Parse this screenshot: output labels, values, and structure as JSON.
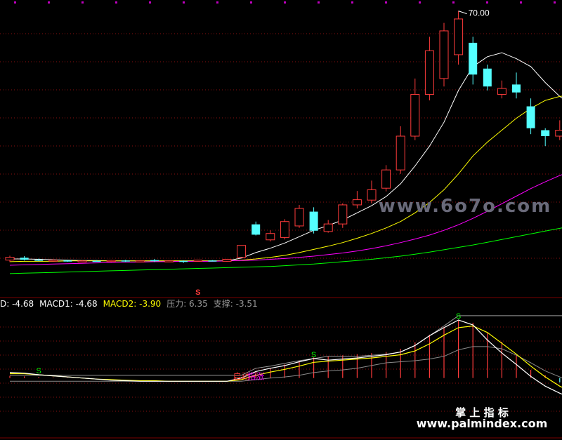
{
  "chart_data": [
    {
      "type": "candlestick",
      "pane": "price",
      "price_annotation": "70.00",
      "candles": [
        {
          "o": 7.3,
          "h": 8.4,
          "l": 6.8,
          "c": 8.0,
          "color": "up"
        },
        {
          "o": 7.9,
          "h": 8.3,
          "l": 7.2,
          "c": 7.4,
          "color": "down"
        },
        {
          "o": 7.4,
          "h": 7.7,
          "l": 7.0,
          "c": 7.2,
          "color": "down"
        },
        {
          "o": 7.2,
          "h": 7.5,
          "l": 6.9,
          "c": 7.3,
          "color": "up"
        },
        {
          "o": 7.2,
          "h": 7.4,
          "l": 6.9,
          "c": 7.1,
          "color": "down"
        },
        {
          "o": 7.0,
          "h": 7.3,
          "l": 6.8,
          "c": 7.1,
          "color": "up"
        },
        {
          "o": 7.1,
          "h": 7.3,
          "l": 6.9,
          "c": 7.0,
          "color": "down"
        },
        {
          "o": 7.0,
          "h": 7.3,
          "l": 6.8,
          "c": 7.2,
          "color": "up"
        },
        {
          "o": 7.2,
          "h": 7.4,
          "l": 6.8,
          "c": 7.0,
          "color": "down"
        },
        {
          "o": 7.0,
          "h": 7.3,
          "l": 6.8,
          "c": 7.1,
          "color": "up"
        },
        {
          "o": 7.1,
          "h": 7.6,
          "l": 6.8,
          "c": 7.3,
          "color": "down"
        },
        {
          "o": 7.1,
          "h": 7.3,
          "l": 6.9,
          "c": 7.0,
          "color": "up"
        },
        {
          "o": 7.0,
          "h": 7.2,
          "l": 6.6,
          "c": 7.1,
          "color": "down"
        },
        {
          "o": 7.0,
          "h": 7.4,
          "l": 6.9,
          "c": 7.3,
          "color": "up"
        },
        {
          "o": 7.2,
          "h": 7.3,
          "l": 7.0,
          "c": 7.1,
          "color": "down"
        },
        {
          "o": 7.0,
          "h": 7.6,
          "l": 6.9,
          "c": 7.5,
          "color": "up"
        },
        {
          "o": 8.0,
          "h": 11.0,
          "l": 7.9,
          "c": 11.0,
          "color": "up"
        },
        {
          "o": 16.3,
          "h": 17.0,
          "l": 13.5,
          "c": 13.7,
          "color": "down"
        },
        {
          "o": 12.4,
          "h": 14.8,
          "l": 12.0,
          "c": 14.0,
          "color": "up"
        },
        {
          "o": 13.0,
          "h": 17.6,
          "l": 12.5,
          "c": 17.0,
          "color": "up"
        },
        {
          "o": 15.9,
          "h": 21.2,
          "l": 15.4,
          "c": 20.3,
          "color": "up"
        },
        {
          "o": 19.5,
          "h": 20.6,
          "l": 14.0,
          "c": 14.7,
          "color": "down"
        },
        {
          "o": 14.5,
          "h": 17.4,
          "l": 14.2,
          "c": 16.4,
          "color": "up"
        },
        {
          "o": 16.4,
          "h": 21.6,
          "l": 15.4,
          "c": 21.2,
          "color": "up"
        },
        {
          "o": 21.2,
          "h": 24.7,
          "l": 20.3,
          "c": 22.5,
          "color": "up"
        },
        {
          "o": 22.4,
          "h": 27.3,
          "l": 21.6,
          "c": 25.0,
          "color": "up"
        },
        {
          "o": 25.4,
          "h": 31.2,
          "l": 24.6,
          "c": 30.0,
          "color": "up"
        },
        {
          "o": 30.0,
          "h": 41.0,
          "l": 29.0,
          "c": 38.5,
          "color": "up"
        },
        {
          "o": 38.5,
          "h": 53.0,
          "l": 37.5,
          "c": 49.0,
          "color": "up"
        },
        {
          "o": 49.0,
          "h": 63.5,
          "l": 47.5,
          "c": 60.0,
          "color": "up"
        },
        {
          "o": 53.0,
          "h": 67.0,
          "l": 51.0,
          "c": 65.0,
          "color": "up"
        },
        {
          "o": 59.0,
          "h": 70.0,
          "l": 56.5,
          "c": 68.0,
          "color": "up"
        },
        {
          "o": 62.0,
          "h": 63.5,
          "l": 51.5,
          "c": 54.0,
          "color": "down"
        },
        {
          "o": 55.5,
          "h": 56.5,
          "l": 50.0,
          "c": 51.0,
          "color": "down"
        },
        {
          "o": 50.5,
          "h": 52.5,
          "l": 48.0,
          "c": 49.0,
          "color": "up"
        },
        {
          "o": 51.5,
          "h": 54.5,
          "l": 48.0,
          "c": 49.5,
          "color": "down"
        },
        {
          "o": 46.0,
          "h": 48.0,
          "l": 39.0,
          "c": 40.5,
          "color": "down"
        },
        {
          "o": 40.0,
          "h": 40.5,
          "l": 36.0,
          "c": 38.5,
          "color": "down"
        },
        {
          "o": 40.0,
          "h": 42.5,
          "l": 37.5,
          "c": 38.5,
          "color": "up"
        },
        {
          "o": 40.0,
          "h": 42.5,
          "l": 37.0,
          "c": 40.0,
          "color": "down"
        },
        {
          "o": 40.5,
          "h": 42.5,
          "l": 36.0,
          "c": 39.0,
          "color": "down"
        },
        {
          "o": 39.0,
          "h": 42.5,
          "l": 35.0,
          "c": 41.0,
          "color": "up"
        }
      ],
      "ma_lines": [
        {
          "color": "#ffffff",
          "values": [
            7.6,
            7.6,
            7.5,
            7.4,
            7.3,
            7.2,
            7.2,
            7.1,
            7.1,
            7.1,
            7.1,
            7.1,
            7.1,
            7.1,
            7.1,
            7.1,
            7.8,
            9.2,
            10.3,
            11.6,
            13.2,
            14.8,
            16.0,
            17.4,
            19.2,
            21.0,
            23.3,
            26.5,
            31.0,
            36.0,
            42.0,
            50.0,
            56.0,
            58.5,
            59.5,
            58.0,
            56.0,
            52.0,
            48.5,
            46.0,
            44.5,
            43.0
          ]
        },
        {
          "color": "#ffff00",
          "values": [
            6.9,
            7.0,
            7.0,
            7.0,
            7.1,
            7.1,
            7.1,
            7.1,
            7.1,
            7.1,
            7.1,
            7.1,
            7.1,
            7.1,
            7.1,
            7.1,
            7.3,
            7.6,
            8.0,
            8.5,
            9.2,
            10.0,
            10.8,
            11.7,
            12.8,
            14.0,
            15.4,
            17.0,
            19.2,
            21.8,
            25.0,
            29.0,
            33.5,
            37.0,
            40.0,
            43.0,
            45.5,
            47.5,
            48.5,
            49.0,
            48.0,
            46.5
          ]
        },
        {
          "color": "#ff00ff",
          "values": [
            6.0,
            6.1,
            6.2,
            6.3,
            6.4,
            6.5,
            6.6,
            6.7,
            6.8,
            6.8,
            6.9,
            6.9,
            7.0,
            7.0,
            7.0,
            7.1,
            7.2,
            7.3,
            7.5,
            7.7,
            8.0,
            8.3,
            8.7,
            9.1,
            9.6,
            10.2,
            10.9,
            11.7,
            12.6,
            13.6,
            14.8,
            16.2,
            17.8,
            19.6,
            21.5,
            23.4,
            25.3,
            27.0,
            28.6,
            30.0,
            31.4,
            32.6
          ]
        },
        {
          "color": "#00ff00",
          "values": [
            3.9,
            4.0,
            4.1,
            4.2,
            4.3,
            4.4,
            4.5,
            4.6,
            4.7,
            4.8,
            4.9,
            5.0,
            5.1,
            5.2,
            5.3,
            5.4,
            5.5,
            5.6,
            5.7,
            5.9,
            6.1,
            6.3,
            6.6,
            6.9,
            7.2,
            7.5,
            7.9,
            8.3,
            8.8,
            9.3,
            9.9,
            10.5,
            11.1,
            11.8,
            12.5,
            13.2,
            13.9,
            14.6,
            15.3,
            16.0,
            16.7,
            17.6
          ]
        }
      ],
      "signal_markers": [
        {
          "index": 13,
          "label": "S",
          "color": "#ff3b3b"
        }
      ]
    },
    {
      "type": "macd",
      "pane": "indicator",
      "legend": [
        {
          "label": "D:",
          "value": "-4.68",
          "color": "#ffffff"
        },
        {
          "label": "MACD1:",
          "value": "-4.68",
          "color": "#ffffff"
        },
        {
          "label": "MACD2:",
          "value": "-3.90",
          "color": "#ffff00"
        },
        {
          "label": "压力:",
          "value": "6.35",
          "color": "#9a9a9a"
        },
        {
          "label": "支撑:",
          "value": "-3.51",
          "color": "#9a9a9a"
        }
      ],
      "macd1": [
        1.0,
        0.9,
        0.6,
        0.4,
        0.2,
        0.0,
        -0.2,
        -0.4,
        -0.5,
        -0.6,
        -0.6,
        -0.6,
        -0.6,
        -0.6,
        -0.6,
        -0.6,
        0.0,
        1.2,
        1.8,
        2.3,
        3.0,
        3.6,
        3.3,
        3.5,
        3.7,
        4.0,
        4.3,
        4.8,
        6.0,
        7.8,
        9.3,
        10.7,
        9.8,
        7.0,
        4.6,
        2.5,
        0.3,
        -1.5,
        -2.8,
        -3.9,
        -4.68,
        -4.68
      ],
      "macd2": [
        0.8,
        0.8,
        0.6,
        0.4,
        0.2,
        0.0,
        -0.2,
        -0.3,
        -0.4,
        -0.5,
        -0.5,
        -0.6,
        -0.6,
        -0.6,
        -0.6,
        -0.6,
        -0.3,
        0.5,
        1.1,
        1.6,
        2.2,
        2.9,
        3.1,
        3.3,
        3.5,
        3.7,
        4.0,
        4.3,
        5.0,
        6.3,
        7.9,
        9.3,
        9.6,
        8.4,
        6.4,
        4.4,
        2.2,
        0.2,
        -1.5,
        -2.8,
        -3.9,
        -3.9
      ],
      "hist": [
        0.4,
        0.3,
        0.2,
        0.1,
        0.05,
        0.02,
        0.01,
        0.0,
        0.0,
        0.0,
        0.0,
        0.0,
        0.0,
        0.0,
        0.0,
        0.0,
        0.2,
        1.3,
        1.8,
        2.5,
        3.2,
        3.8,
        4.0,
        4.2,
        4.4,
        4.6,
        4.8,
        5.4,
        6.6,
        8.0,
        9.4,
        10.7,
        10.2,
        8.3,
        6.7,
        4.2,
        1.5,
        0.5,
        -0.8,
        -2.5,
        -2.8,
        -3.5
      ],
      "pressure": [
        0.5,
        0.5,
        0.5,
        0.5,
        0.5,
        0.5,
        0.5,
        0.5,
        0.5,
        0.5,
        0.5,
        0.5,
        0.5,
        0.5,
        0.5,
        0.5,
        0.5,
        1.8,
        2.2,
        2.7,
        3.2,
        3.6,
        4.0,
        4.0,
        4.0,
        4.2,
        4.4,
        4.8,
        6.0,
        7.8,
        9.6,
        11.5,
        11.5,
        11.5,
        11.5,
        11.5,
        11.5,
        11.5,
        11.5,
        11.5,
        11.5,
        11.5
      ],
      "support": [
        -0.6,
        -0.6,
        -0.6,
        -0.6,
        -0.6,
        -0.6,
        -0.6,
        -0.6,
        -0.6,
        -0.6,
        -0.6,
        -0.6,
        -0.6,
        -0.6,
        -0.6,
        -0.6,
        -0.6,
        -0.3,
        0.0,
        0.2,
        0.5,
        1.0,
        1.3,
        1.5,
        1.8,
        2.3,
        2.8,
        3.0,
        3.2,
        3.5,
        4.0,
        5.2,
        5.8,
        5.8,
        5.4,
        4.2,
        2.8,
        1.3,
        0.2,
        -1.0,
        -2.5,
        -3.51
      ],
      "signal_markers": [
        {
          "index": 2,
          "label": "S",
          "color": "#00ff00"
        },
        {
          "index": 21,
          "label": "S",
          "color": "#00ff00"
        },
        {
          "index": 31,
          "label": "S",
          "color": "#00ff00"
        }
      ],
      "annotations": [
        {
          "index": 16,
          "label": "启动",
          "color": "#ff3b3b"
        },
        {
          "index": 17,
          "label": "指涨",
          "color": "#ff00ff"
        }
      ]
    }
  ],
  "watermarks": {
    "main": "www.6o7o.com",
    "brand_line1": "掌 上 指 标",
    "brand_line2": "www.palmindex.com"
  },
  "colors": {
    "up": "#ff3b3b",
    "down": "#54ffff",
    "background": "#000000",
    "grid": "#8a0f0f"
  }
}
